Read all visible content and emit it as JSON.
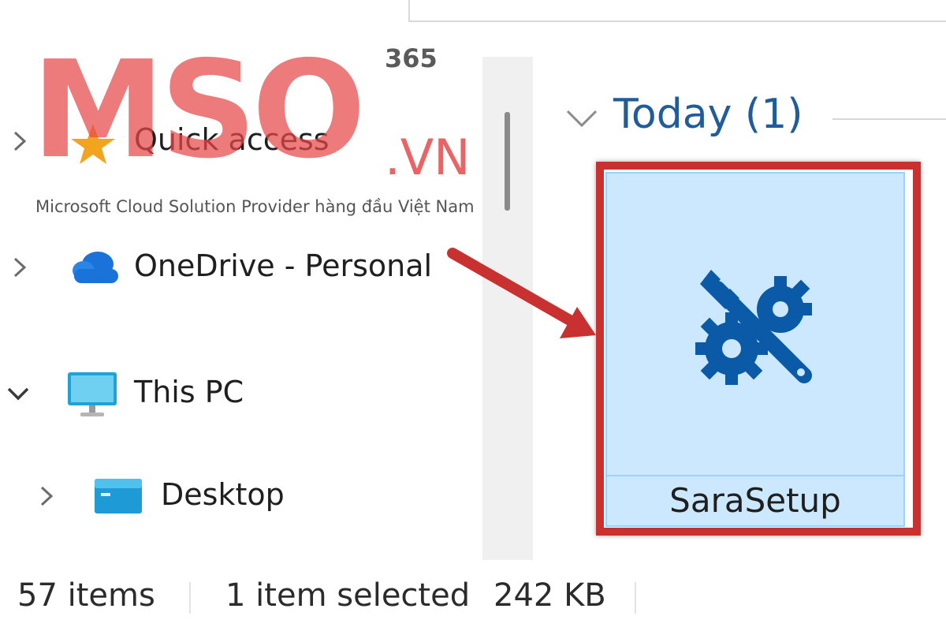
{
  "nav": {
    "items": [
      {
        "label": "Quick access",
        "icon": "star-icon",
        "expanded": false
      },
      {
        "label": "OneDrive - Personal",
        "icon": "cloud-icon",
        "expanded": false
      },
      {
        "label": "This PC",
        "icon": "monitor-icon",
        "expanded": true
      },
      {
        "label": "Desktop",
        "icon": "desktop-folder-icon",
        "expanded": false
      }
    ]
  },
  "content": {
    "group": {
      "title": "Today (1)"
    },
    "file": {
      "name": "SaraSetup",
      "icon": "wrench-gear-icon",
      "selected": true
    }
  },
  "status": {
    "items_count": "57 items",
    "selected": "1 item selected",
    "size": "242 KB"
  },
  "watermark": {
    "brand": "MSO",
    "superscript": "365",
    "suffix": ".VN",
    "tagline": "Microsoft Cloud Solution Provider hàng đầu Việt Nam"
  },
  "colors": {
    "highlight": "#c8312f",
    "selection": "#cce8ff",
    "group_title": "#1f5c99",
    "icon_blue": "#0b5aa8"
  }
}
